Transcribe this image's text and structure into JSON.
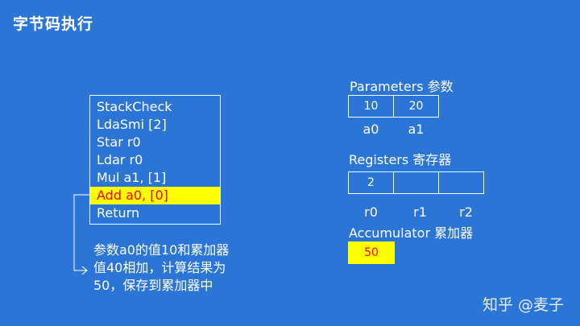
{
  "title": "字节码执行",
  "bytecode": {
    "lines": [
      {
        "text": "StackCheck",
        "highlighted": false
      },
      {
        "text": "LdaSmi [2]",
        "highlighted": false
      },
      {
        "text": "Star r0",
        "highlighted": false
      },
      {
        "text": "Ldar r0",
        "highlighted": false
      },
      {
        "text": "Mul a1, [1]",
        "highlighted": false
      },
      {
        "text": "Add a0, [0]",
        "highlighted": true
      },
      {
        "text": "Return",
        "highlighted": false
      }
    ]
  },
  "note": {
    "line1": "参数a0的值10和累加器",
    "line2": "值40相加，计算结果为",
    "line3": "50，保存到累加器中"
  },
  "parameters": {
    "label": "Parameters 参数",
    "cells": [
      "10",
      "20"
    ],
    "names": [
      "a0",
      "a1"
    ]
  },
  "registers": {
    "label": "Registers 寄存器",
    "cells": [
      "2",
      "",
      ""
    ],
    "names": [
      "r0",
      "r1",
      "r2"
    ]
  },
  "accumulator": {
    "label": "Accumulator 累加器",
    "value": "50"
  },
  "watermark": "知乎 @麦子",
  "colors": {
    "background": "#2b75d6",
    "highlight": "#ffff00",
    "highlight_text": "#ff0000"
  }
}
